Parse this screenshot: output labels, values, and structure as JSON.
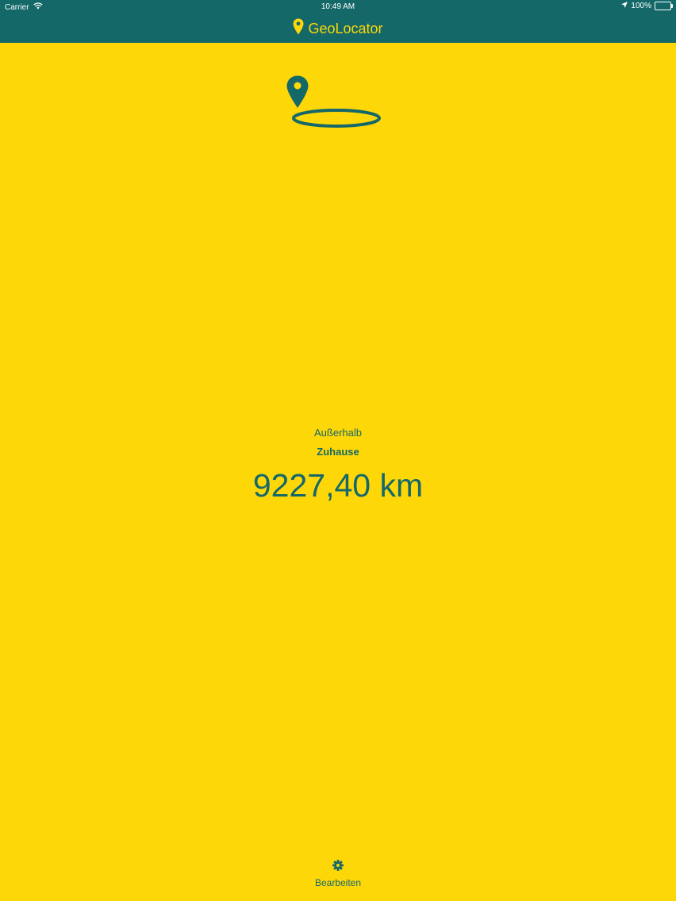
{
  "status_bar": {
    "carrier": "Carrier",
    "time": "10:49 AM",
    "battery": "100%"
  },
  "nav": {
    "title": "GeoLocator",
    "icon": "map-pin-icon"
  },
  "location": {
    "status": "Außerhalb",
    "zone": "Zuhause",
    "distance": "9227,40 km"
  },
  "toolbar": {
    "edit_label": "Bearbeiten",
    "edit_icon": "gear-icon"
  },
  "colors": {
    "background": "#FED709",
    "primary": "#146868",
    "nav_title": "#FED709"
  }
}
